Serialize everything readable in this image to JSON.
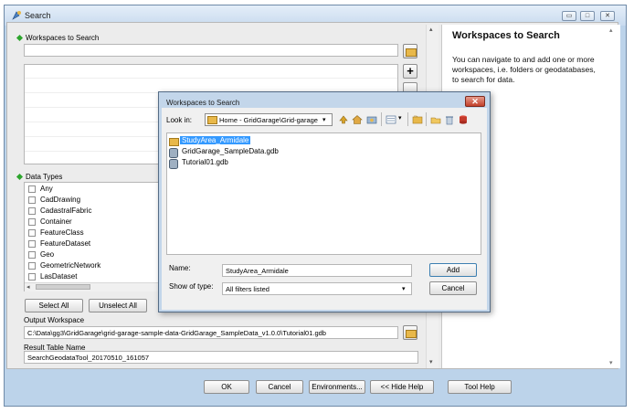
{
  "window": {
    "title": "Search"
  },
  "workspaces": {
    "label": "Workspaces to Search",
    "input_value": ""
  },
  "data_types": {
    "label": "Data Types",
    "items": [
      "Any",
      "CadDrawing",
      "CadastralFabric",
      "Container",
      "FeatureClass",
      "FeatureDataset",
      "Geo",
      "GeometricNetwork",
      "LasDataset"
    ]
  },
  "buttons": {
    "select_all": "Select All",
    "unselect_all": "Unselect All",
    "ok": "OK",
    "cancel": "Cancel",
    "environments": "Environments...",
    "hide_help": "<< Hide Help",
    "tool_help": "Tool Help"
  },
  "output_workspace": {
    "label": "Output Workspace",
    "value": "C:\\Data\\gg3\\GridGarage\\grid-garage-sample-data-GridGarage_SampleData_v1.0.0\\Tutorial01.gdb"
  },
  "result_table": {
    "label": "Result Table Name",
    "value": "SearchGeodataTool_20170510_161057"
  },
  "help_panel": {
    "title": "Workspaces to Search",
    "body": "You can navigate to and add one or more workspaces, i.e. folders or geodatabases, to search for data."
  },
  "dialog": {
    "title": "Workspaces to Search",
    "look_in_label": "Look in:",
    "look_in_value": "Home - GridGarage\\Grid-garage",
    "files": [
      {
        "name": "StudyArea_Armidale",
        "type": "folder",
        "selected": true
      },
      {
        "name": "GridGarage_SampleData.gdb",
        "type": "gdb",
        "selected": false
      },
      {
        "name": "Tutorial01.gdb",
        "type": "gdb",
        "selected": false
      }
    ],
    "name_label": "Name:",
    "name_value": "StudyArea_Armidale",
    "type_label": "Show of type:",
    "type_value": "All filters listed",
    "add_button": "Add",
    "cancel_button": "Cancel"
  }
}
